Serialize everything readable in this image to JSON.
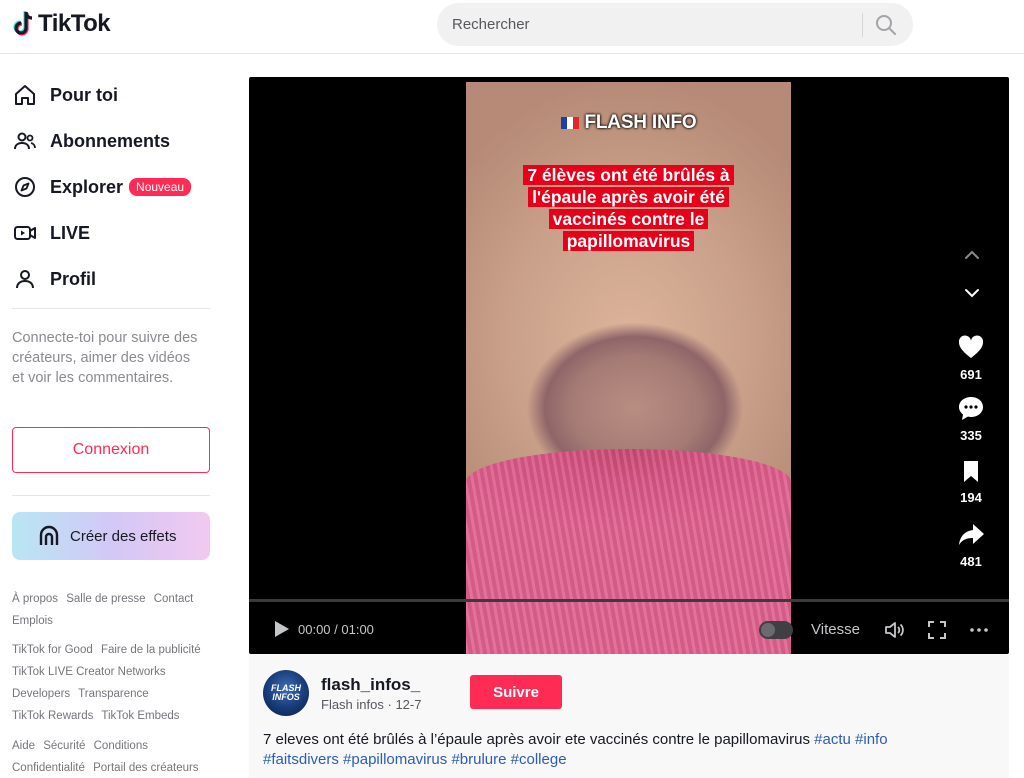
{
  "header": {
    "logo_text": "TikTok",
    "search_placeholder": "Rechercher"
  },
  "sidebar": {
    "nav": [
      {
        "label": "Pour toi",
        "icon": "home-icon"
      },
      {
        "label": "Abonnements",
        "icon": "users-icon"
      },
      {
        "label": "Explorer",
        "icon": "compass-icon",
        "badge": "Nouveau"
      },
      {
        "label": "LIVE",
        "icon": "live-camera-icon"
      },
      {
        "label": "Profil",
        "icon": "person-icon"
      }
    ],
    "login_hint": "Connecte-toi pour suivre des créateurs, aimer des vidéos et voir les commentaires.",
    "login_button": "Connexion",
    "effects_button": "Créer des effets",
    "footer_groups": [
      [
        "À propos",
        "Salle de presse",
        "Contact",
        "Emplois"
      ],
      [
        "TikTok for Good",
        "Faire de la publicité",
        "TikTok LIVE Creator Networks",
        "Developers",
        "Transparence",
        "TikTok Rewards",
        "TikTok Embeds"
      ],
      [
        "Aide",
        "Sécurité",
        "Conditions",
        "Confidentialité",
        "Portail des créateurs"
      ]
    ]
  },
  "video": {
    "overlay_title": "FLASH INFO",
    "overlay_headline": "7 élèves ont été brûlés à l'épaule après avoir été vaccinés contre le papillomavirus",
    "likes": "691",
    "comments": "335",
    "saves": "194",
    "shares": "481",
    "time": "00:00 / 01:00",
    "speed_label": "Vitesse"
  },
  "author": {
    "username": "flash_infos_",
    "display_name": "Flash infos",
    "date": "12-7",
    "follow_button": "Suivre",
    "avatar_text": "FLASH INFOS",
    "caption_text": "7 eleves ont été brûlés à l’épaule après avoir ete vaccinés contre le papillomavirus",
    "hashtags": [
      "#actu",
      "#info",
      "#faitsdivers",
      "#papillomavirus",
      "#brulure",
      "#college"
    ]
  },
  "colors": {
    "brand": "#fe2c55",
    "hashtag": "#2b5db9",
    "headline_bg": "#e6001a"
  }
}
